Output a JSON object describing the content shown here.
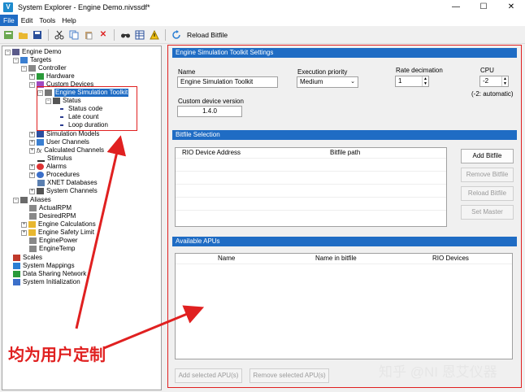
{
  "window": {
    "title": "System Explorer - Engine Demo.nivssdf*",
    "app_icon": "V",
    "minimize": "—",
    "maximize": "☐",
    "close": "✕"
  },
  "menu": [
    "File",
    "Edit",
    "Tools",
    "Help"
  ],
  "toolbar": {
    "reload_bitfile": "Reload Bitfile"
  },
  "tree": {
    "root": "Engine Demo",
    "targets": "Targets",
    "controller": "Controller",
    "hardware": "Hardware",
    "custom_devices": "Custom Devices",
    "est": "Engine Simulation Toolkit",
    "status": "Status",
    "status_code": "Status code",
    "late_count": "Late count",
    "loop_duration": "Loop duration",
    "simulation_models": "Simulation Models",
    "user_channels": "User Channels",
    "calculated_channels": "Calculated Channels",
    "stimulus": "Stimulus",
    "alarms": "Alarms",
    "procedures": "Procedures",
    "xnet": "XNET Databases",
    "system_channels": "System Channels",
    "aliases": "Aliases",
    "actual_rpm": "ActualRPM",
    "desired_rpm": "DesiredRPM",
    "engine_calculations": "Engine Calculations",
    "engine_safety": "Engine Safety Limit",
    "engine_power": "EnginePower",
    "engine_temp": "EngineTemp",
    "scales": "Scales",
    "system_mappings": "System Mappings",
    "data_sharing": "Data Sharing Network",
    "system_init": "System Initialization"
  },
  "settings": {
    "header": "Engine Simulation Toolkit Settings",
    "name_label": "Name",
    "name_value": "Engine Simulation Toolkit",
    "priority_label": "Execution priority",
    "priority_value": "Medium",
    "rate_label": "Rate decimation",
    "rate_value": "1",
    "cpu_label": "CPU",
    "cpu_value": "-2",
    "cpu_hint": "(-2: automatic)",
    "version_label": "Custom device version",
    "version_value": "1.4.0"
  },
  "bitfile": {
    "header": "Bitfile Selection",
    "columns": [
      "RIO Device Address",
      "Bitfile path"
    ],
    "add": "Add Bitfile",
    "remove": "Remove Bitfile",
    "reload": "Reload Bitfile",
    "set_master": "Set Master"
  },
  "apus": {
    "header": "Available APUs",
    "columns": [
      "Name",
      "Name in bitfile",
      "RIO Devices"
    ],
    "add_selected": "Add selected APU(s)",
    "remove_selected": "Remove selected APU(s)"
  },
  "annotation": "均为用户定制",
  "watermark": "知乎 @NI 恩艾仪器",
  "colors": {
    "accent": "#1f6cc4",
    "annotation": "#e02020"
  }
}
